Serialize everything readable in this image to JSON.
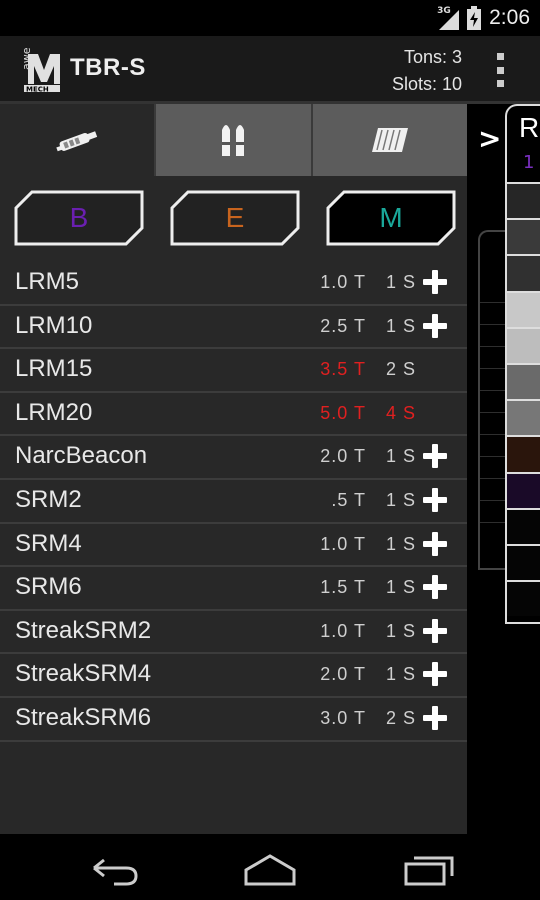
{
  "status_bar": {
    "network": "3G",
    "time": "2:06",
    "icons": [
      "signal-icon",
      "battery-icon"
    ]
  },
  "action_bar": {
    "logo_text": "awe MECH",
    "title": "TBR-S",
    "tons_label": "Tons: 3",
    "slots_label": "Slots: 10",
    "overflow_icon": "overflow-menu-icon"
  },
  "tabs": [
    {
      "icon": "weapon-icon",
      "active": true
    },
    {
      "icon": "ammo-icon",
      "active": false
    },
    {
      "icon": "armor-icon",
      "active": false
    }
  ],
  "next_label": ">",
  "categories": [
    {
      "label": "B",
      "color": "#6a1fb0",
      "selected": false
    },
    {
      "label": "E",
      "color": "#c8641e",
      "selected": false
    },
    {
      "label": "M",
      "color": "#1aa89a",
      "selected": true
    }
  ],
  "weapons": [
    {
      "name": "LRM5",
      "tons": "1.0 T",
      "slots": "1 S",
      "addable": true,
      "warn_tons": false,
      "warn_slots": false
    },
    {
      "name": "LRM10",
      "tons": "2.5 T",
      "slots": "1 S",
      "addable": true,
      "warn_tons": false,
      "warn_slots": false
    },
    {
      "name": "LRM15",
      "tons": "3.5 T",
      "slots": "2 S",
      "addable": false,
      "warn_tons": true,
      "warn_slots": false
    },
    {
      "name": "LRM20",
      "tons": "5.0 T",
      "slots": "4 S",
      "addable": false,
      "warn_tons": true,
      "warn_slots": true
    },
    {
      "name": "NarcBeacon",
      "tons": "2.0 T",
      "slots": "1 S",
      "addable": true,
      "warn_tons": false,
      "warn_slots": false
    },
    {
      "name": "SRM2",
      "tons": ".5 T",
      "slots": "1 S",
      "addable": true,
      "warn_tons": false,
      "warn_slots": false
    },
    {
      "name": "SRM4",
      "tons": "1.0 T",
      "slots": "1 S",
      "addable": true,
      "warn_tons": false,
      "warn_slots": false
    },
    {
      "name": "SRM6",
      "tons": "1.5 T",
      "slots": "1 S",
      "addable": true,
      "warn_tons": false,
      "warn_slots": false
    },
    {
      "name": "StreakSRM2",
      "tons": "1.0 T",
      "slots": "1 S",
      "addable": true,
      "warn_tons": false,
      "warn_slots": false
    },
    {
      "name": "StreakSRM4",
      "tons": "2.0 T",
      "slots": "1 S",
      "addable": true,
      "warn_tons": false,
      "warn_slots": false
    },
    {
      "name": "StreakSRM6",
      "tons": "3.0 T",
      "slots": "2 S",
      "addable": true,
      "warn_tons": false,
      "warn_slots": false
    }
  ],
  "side_panel": {
    "letter": "R",
    "sub_label": "1",
    "slot_colors": [
      "#262626",
      "#3a3a3a",
      "#303030",
      "#c8c8c8",
      "#bdbdbd",
      "#6a6a6a",
      "#777777",
      "#2a150c",
      "#1a0a28",
      "#050505",
      "#050505",
      "#050505"
    ]
  },
  "nav_bar": {
    "back_icon": "back-icon",
    "home_icon": "home-icon",
    "recents_icon": "recents-icon"
  }
}
